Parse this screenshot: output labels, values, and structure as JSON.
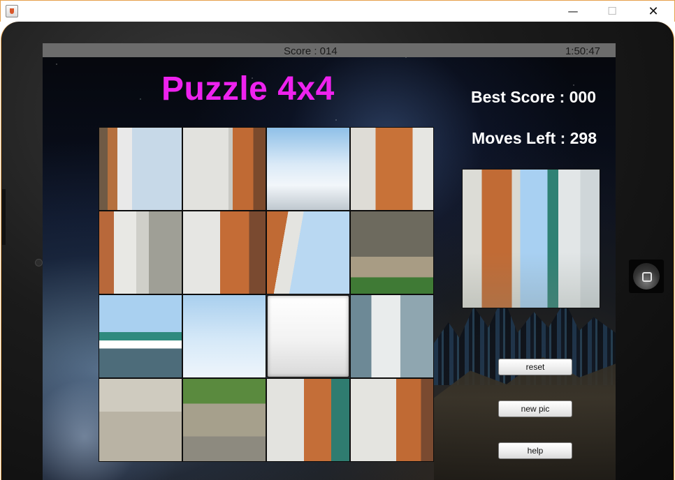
{
  "window": {
    "minimize_glyph": "—",
    "maximize_glyph": "☐",
    "close_glyph": "✕"
  },
  "status": {
    "score": "Score : 014",
    "time": "1:50:47"
  },
  "game": {
    "title": "Puzzle 4x4",
    "best_score": "Best Score : 000",
    "moves_left": "Moves Left : 298"
  },
  "buttons": {
    "reset": "reset",
    "new_pic": "new pic",
    "help": "help"
  },
  "tiles": [
    {
      "row": 0,
      "col": 0,
      "blank": false
    },
    {
      "row": 0,
      "col": 1,
      "blank": false
    },
    {
      "row": 0,
      "col": 2,
      "blank": false
    },
    {
      "row": 0,
      "col": 3,
      "blank": false
    },
    {
      "row": 1,
      "col": 0,
      "blank": false
    },
    {
      "row": 1,
      "col": 1,
      "blank": false
    },
    {
      "row": 1,
      "col": 2,
      "blank": false
    },
    {
      "row": 1,
      "col": 3,
      "blank": false
    },
    {
      "row": 2,
      "col": 0,
      "blank": false
    },
    {
      "row": 2,
      "col": 1,
      "blank": false
    },
    {
      "row": 2,
      "col": 2,
      "blank": true
    },
    {
      "row": 2,
      "col": 3,
      "blank": false
    },
    {
      "row": 3,
      "col": 0,
      "blank": false
    },
    {
      "row": 3,
      "col": 1,
      "blank": false
    },
    {
      "row": 3,
      "col": 2,
      "blank": false
    },
    {
      "row": 3,
      "col": 3,
      "blank": false
    }
  ]
}
